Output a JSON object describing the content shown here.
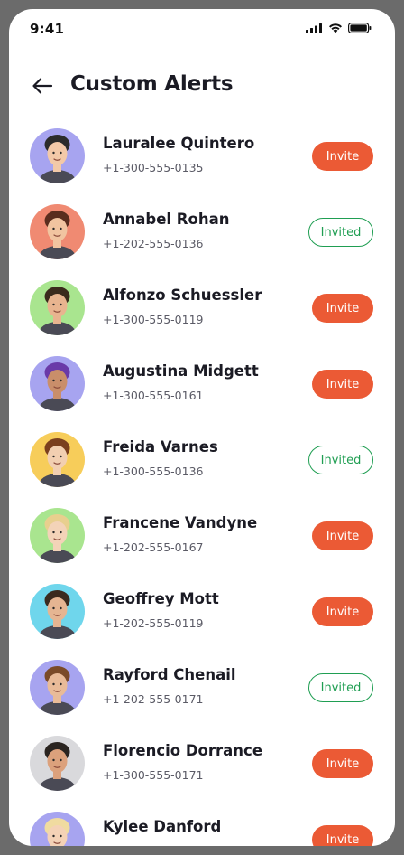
{
  "status_bar": {
    "time": "9:41"
  },
  "header": {
    "title": "Custom Alerts",
    "back_icon": "arrow-left-icon"
  },
  "colors": {
    "invite_bg": "#eb5a35",
    "invited_border": "#1f9e52"
  },
  "contacts": [
    {
      "name": "Lauralee Quintero",
      "phone": "+1-300-555-0135",
      "action": "Invite",
      "avatar_bg": "#a7a4f0"
    },
    {
      "name": "Annabel Rohan",
      "phone": "+1-202-555-0136",
      "action": "Invited",
      "avatar_bg": "#f08a72"
    },
    {
      "name": "Alfonzo Schuessler",
      "phone": "+1-300-555-0119",
      "action": "Invite",
      "avatar_bg": "#a9e58f"
    },
    {
      "name": "Augustina Midgett",
      "phone": "+1-300-555-0161",
      "action": "Invite",
      "avatar_bg": "#a7a4f0"
    },
    {
      "name": "Freida Varnes",
      "phone": "+1-300-555-0136",
      "action": "Invited",
      "avatar_bg": "#f7cd5a"
    },
    {
      "name": "Francene Vandyne",
      "phone": "+1-202-555-0167",
      "action": "Invite",
      "avatar_bg": "#a9e58f"
    },
    {
      "name": "Geoffrey Mott",
      "phone": "+1-202-555-0119",
      "action": "Invite",
      "avatar_bg": "#6fd6ec"
    },
    {
      "name": "Rayford Chenail",
      "phone": "+1-202-555-0171",
      "action": "Invited",
      "avatar_bg": "#a7a4f0"
    },
    {
      "name": "Florencio Dorrance",
      "phone": "+1-300-555-0171",
      "action": "Invite",
      "avatar_bg": "#d9d9dc"
    },
    {
      "name": "Kylee Danford",
      "phone": "",
      "action": "Invite",
      "avatar_bg": "#a7a4f0"
    }
  ]
}
